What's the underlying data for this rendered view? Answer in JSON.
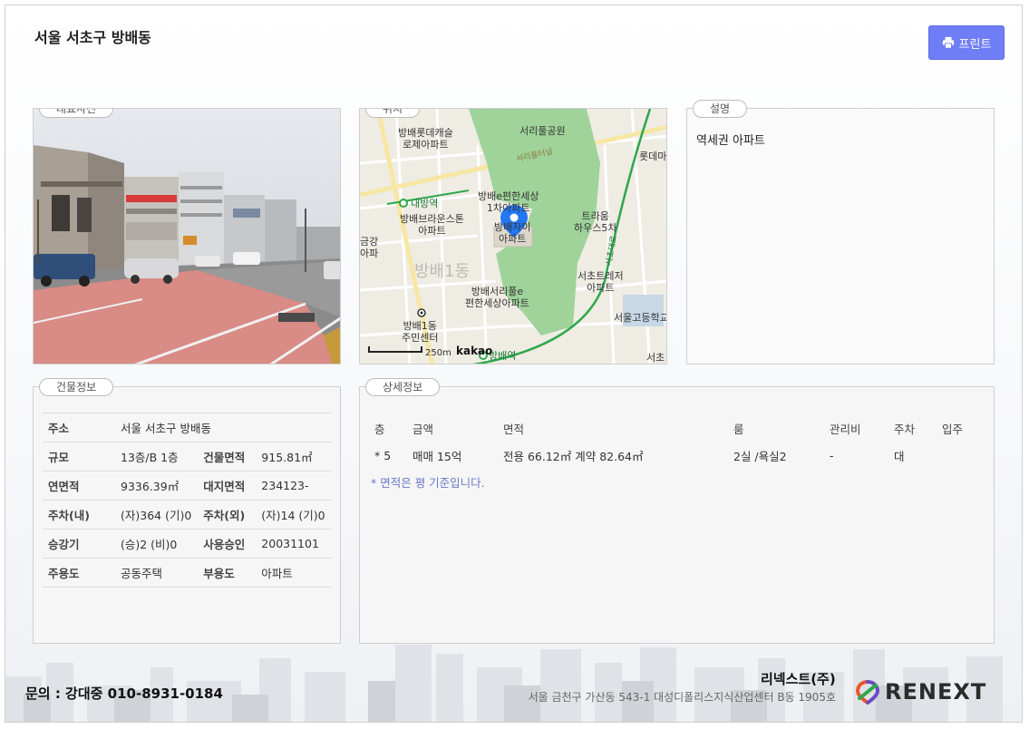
{
  "page": {
    "title": "서울 서초구 방배동",
    "print_label": "프린트"
  },
  "panels": {
    "photo_tab": "대표사진",
    "map_tab": "위치",
    "desc_tab": "설명",
    "bldg_tab": "건물정보",
    "detail_tab": "상세정보"
  },
  "description": "역세권 아파트",
  "map": {
    "labels": {
      "seorae_park": "서리풀공원",
      "lotte_castle": "방배롯데캐슬\n로제아파트",
      "naebang_station": "내방역",
      "brownstone": "방배브라운스톤\n아파트",
      "pyeonhan_1": "방배e편한세상\n1차아파트",
      "target": "방배자이\n아파트",
      "trium": "트라움\n하우스5차",
      "dong_label": "방배1동",
      "seorepul": "방배서리풀e\n편한세상아파트",
      "seocho_treasure": "서초트레저\n아파트",
      "community_center": "방배1동\n주민센터",
      "seoul_high": "서울고등학교",
      "bangbae_station": "방배역",
      "lotte_mart": "롯데마",
      "geumgang": "금강\n아파",
      "seocho": "서초",
      "rd_seorae": "서리풀터널",
      "rd_seocho": "서초대로"
    },
    "scale": "250m",
    "brand": "kakao"
  },
  "building_info": {
    "rows": [
      {
        "k1": "주소",
        "v1": "서울 서초구 방배동",
        "k2": "",
        "v2": ""
      },
      {
        "k1": "규모",
        "v1": "13층/B 1층",
        "k2": "건물면적",
        "v2": "915.81㎡"
      },
      {
        "k1": "연면적",
        "v1": "9336.39㎡",
        "k2": "대지면적",
        "v2": "234123-"
      },
      {
        "k1": "주차(내)",
        "v1": "(자)364 (기)0",
        "k2": "주차(외)",
        "v2": "(자)14 (기)0"
      },
      {
        "k1": "승강기",
        "v1": "(승)2 (비)0",
        "k2": "사용승인",
        "v2": "20031101"
      },
      {
        "k1": "주용도",
        "v1": "공동주택",
        "k2": "부용도",
        "v2": "아파트"
      }
    ]
  },
  "detail_info": {
    "headers": [
      "층",
      "금액",
      "면적",
      "룸",
      "관리비",
      "주차",
      "입주"
    ],
    "rows": [
      {
        "floor": "* 5",
        "price": "매매 15억",
        "area": "전용 66.12㎡ 계약 82.64㎡",
        "room": "2실 /욕실2",
        "fee": "-",
        "parking": "대",
        "move_in": ""
      }
    ],
    "note": "* 면적은 평 기준입니다."
  },
  "footer": {
    "contact": "문의 : 강대중 010-8931-0184",
    "company": "리넥스트(주)",
    "address": "서울 금천구 가산동 543-1 대성디폴리스지식산업센터 B동 1905호",
    "logo_text": "RENEXT"
  },
  "colors": {
    "print_button": "#6f7ef5",
    "park_green": "#9fd39a",
    "subway_line": "#2ea84b",
    "marker": "#2477f2"
  }
}
